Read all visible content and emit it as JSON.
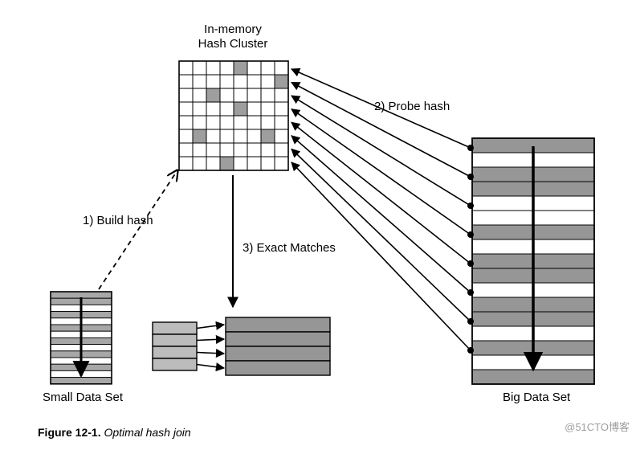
{
  "labels": {
    "hashCluster1": "In-memory",
    "hashCluster2": "Hash Cluster",
    "buildHash": "1) Build hash",
    "probeHash": "2) Probe hash",
    "exactMatches": "3) Exact Matches",
    "smallDataSet": "Small Data Set",
    "bigDataSet": "Big Data Set"
  },
  "caption": {
    "figNum": "Figure 12-1.",
    "title": " Optimal hash join"
  },
  "watermark": "@51CTO博客",
  "hashGrid": {
    "rows": 8,
    "cols": 8,
    "filled": [
      [
        0,
        4
      ],
      [
        1,
        7
      ],
      [
        2,
        2
      ],
      [
        3,
        4
      ],
      [
        5,
        1
      ],
      [
        5,
        6
      ],
      [
        7,
        3
      ]
    ]
  },
  "smallDataSet": {
    "rows": 14,
    "shaded": [
      0,
      1,
      3,
      5,
      7,
      9,
      11,
      13
    ]
  },
  "bigDataSet": {
    "rows": 17,
    "shaded": [
      0,
      2,
      3,
      6,
      8,
      9,
      11,
      12,
      14,
      16
    ]
  },
  "matchPairs": 4
}
